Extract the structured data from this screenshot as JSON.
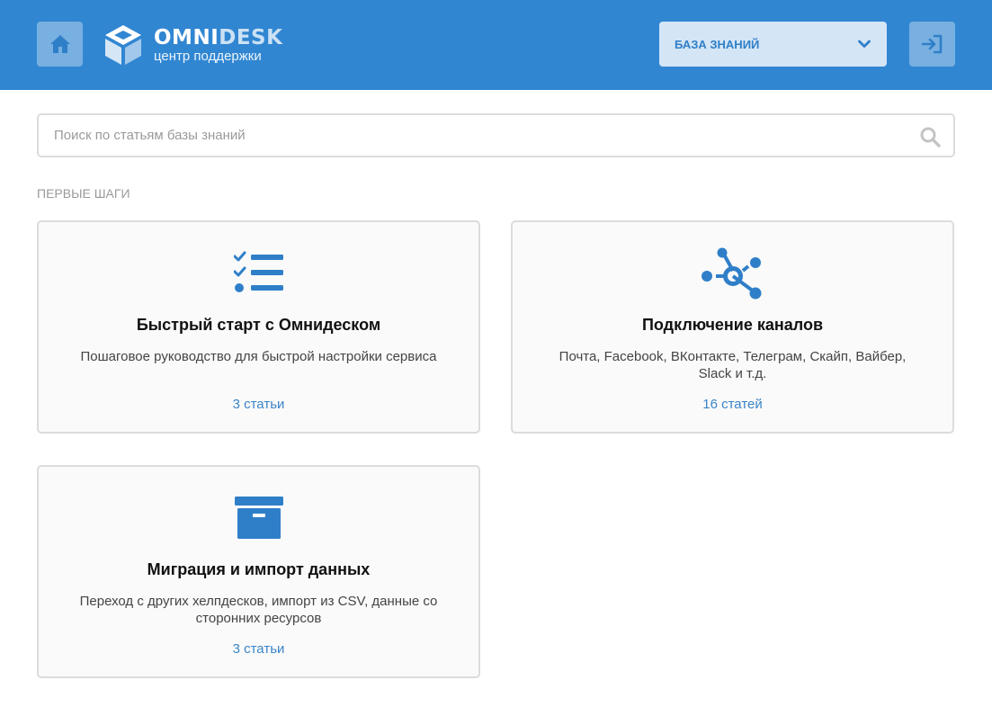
{
  "header": {
    "logo_title_bold": "OMNI",
    "logo_title_light": "DESK",
    "logo_subtitle": "центр поддержки",
    "kb_select_label": "БАЗА ЗНАНИЙ",
    "icons": [
      "home-icon",
      "chevron-down-icon",
      "sign-in-icon"
    ]
  },
  "search": {
    "placeholder": "Поиск по статьям базы знаний",
    "value": ""
  },
  "section": {
    "title": "ПЕРВЫЕ ШАГИ"
  },
  "cards": [
    {
      "icon": "checklist-icon",
      "title": "Быстрый старт с Омнидеском",
      "description": "Пошаговое руководство для быстрой настройки сервиса",
      "count": "3 статьи"
    },
    {
      "icon": "network-icon",
      "title": "Подключение каналов",
      "description": "Почта, Facebook, ВКонтакте, Телеграм, Скайп, Вайбер, Slack и т.д.",
      "count": "16 статей"
    },
    {
      "icon": "archive-box-icon",
      "title": "Миграция и импорт данных",
      "description": "Переход с других хелпдесков, импорт из CSV, данные со сторонних ресурсов",
      "count": "3 статьи"
    }
  ],
  "colors": {
    "header_bg": "#3186d2",
    "accent": "#2f7fc8",
    "card_bg": "#fafafa",
    "card_border": "#dcdcdc"
  }
}
